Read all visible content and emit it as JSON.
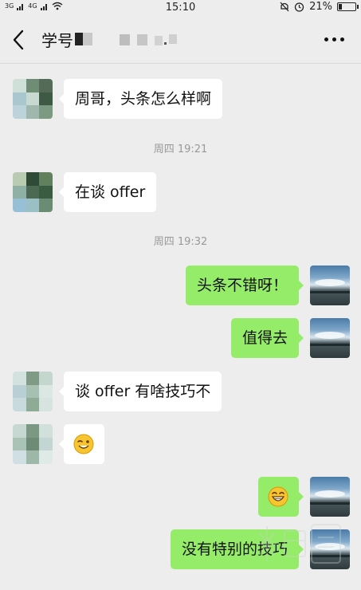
{
  "status": {
    "signal_1": "3G",
    "signal_2": "4G",
    "time": "15:10",
    "battery": "21%",
    "battery_level": 0.21
  },
  "nav": {
    "title": "学号",
    "back_icon": "chevron-left-icon",
    "more_icon": "more-icon"
  },
  "messages": [
    {
      "side": "in",
      "type": "text",
      "text": "周哥，头条怎么样啊"
    },
    {
      "type": "time",
      "text": "周四 19:21"
    },
    {
      "side": "in",
      "type": "text",
      "text": "在谈 offer"
    },
    {
      "type": "time",
      "text": "周四 19:32"
    },
    {
      "side": "out",
      "type": "text",
      "text": "头条不错呀！"
    },
    {
      "side": "out",
      "type": "text",
      "text": "值得去"
    },
    {
      "side": "in",
      "type": "text",
      "text": "谈 offer 有啥技巧不"
    },
    {
      "side": "in",
      "type": "emoji",
      "emoji": "wink-smile-emoji"
    },
    {
      "side": "out",
      "type": "emoji",
      "emoji": "grin-emoji"
    },
    {
      "side": "out",
      "type": "text",
      "text": "没有特别的技巧"
    }
  ],
  "colors": {
    "background": "#ededed",
    "incoming_bubble": "#ffffff",
    "outgoing_bubble": "#95ec69",
    "timestamp": "#999999"
  }
}
